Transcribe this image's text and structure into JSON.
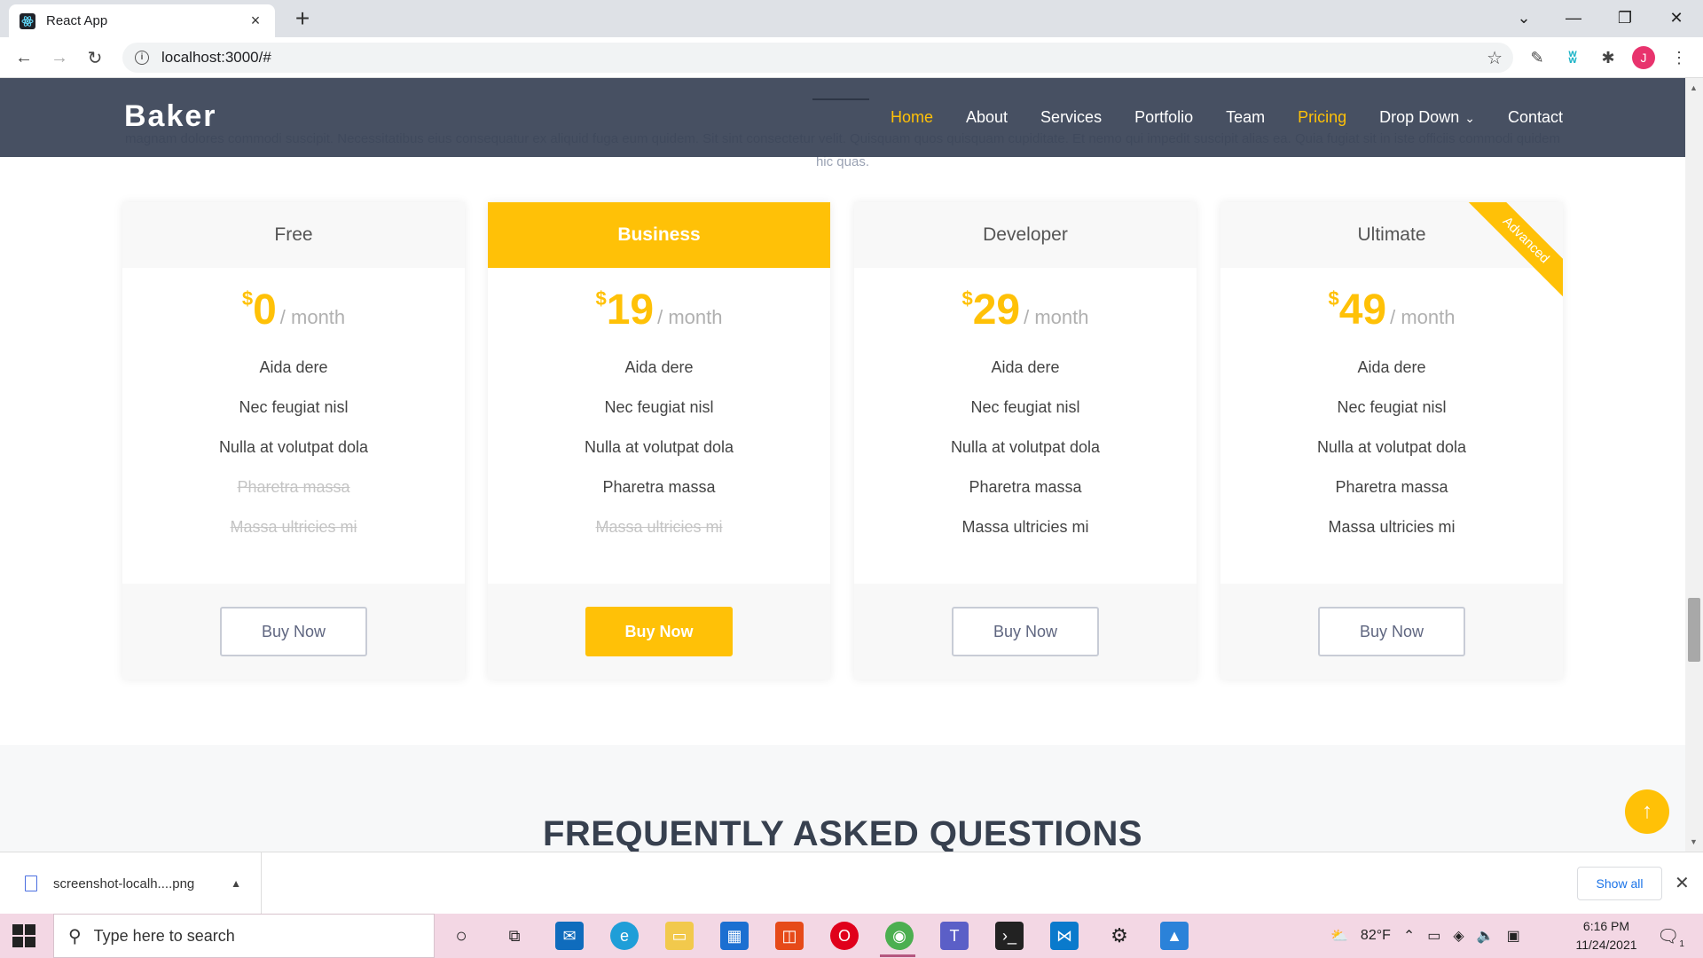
{
  "browser": {
    "tab_title": "React App",
    "tab_close": "×",
    "new_tab": "+",
    "url": "localhost:3000/#",
    "window_controls": [
      "⌄",
      "—",
      "❐",
      "✕"
    ],
    "profile_initial": "J"
  },
  "header": {
    "logo": "Baker",
    "nav": [
      {
        "label": "Home",
        "active": true
      },
      {
        "label": "About",
        "active": false
      },
      {
        "label": "Services",
        "active": false
      },
      {
        "label": "Portfolio",
        "active": false
      },
      {
        "label": "Team",
        "active": false
      },
      {
        "label": "Pricing",
        "active": true
      },
      {
        "label": "Drop Down",
        "active": false
      },
      {
        "label": "Contact",
        "active": false
      }
    ]
  },
  "background_text": "magnam dolores commodi suscipit. Necessitatibus eius consequatur ex aliquid fuga eum quidem. Sit sint consectetur velit. Quisquam quos quisquam cupiditate. Et nemo qui impedit suscipit alias ea. Quia fugiat sit in iste officiis commodi quidem hic quas.",
  "pricing": {
    "cards": [
      {
        "name": "Free",
        "currency": "$",
        "amount": "0",
        "period": "/ month",
        "features": [
          "Aida dere",
          "Nec feugiat nisl",
          "Nulla at volutpat dola",
          "Pharetra massa",
          "Massa ultricies mi"
        ],
        "button": "Buy Now"
      },
      {
        "name": "Business",
        "currency": "$",
        "amount": "19",
        "period": "/ month",
        "features": [
          "Aida dere",
          "Nec feugiat nisl",
          "Nulla at volutpat dola",
          "Pharetra massa",
          "Massa ultricies mi"
        ],
        "button": "Buy Now"
      },
      {
        "name": "Developer",
        "currency": "$",
        "amount": "29",
        "period": "/ month",
        "features": [
          "Aida dere",
          "Nec feugiat nisl",
          "Nulla at volutpat dola",
          "Pharetra massa",
          "Massa ultricies mi"
        ],
        "button": "Buy Now"
      },
      {
        "name": "Ultimate",
        "currency": "$",
        "amount": "49",
        "period": "/ month",
        "ribbon": "Advanced",
        "features": [
          "Aida dere",
          "Nec feugiat nisl",
          "Nulla at volutpat dola",
          "Pharetra massa",
          "Massa ultricies mi"
        ],
        "button": "Buy Now"
      }
    ]
  },
  "faq": {
    "title": "FREQUENTLY ASKED QUESTIONS"
  },
  "back_to_top": "↑",
  "downloads": {
    "file": "screenshot-localh....png",
    "show_all": "Show all"
  },
  "taskbar": {
    "search_placeholder": "Type here to search",
    "weather": "82°F",
    "time": "6:16 PM",
    "date": "11/24/2021",
    "notification_count": "1"
  },
  "colors": {
    "accent": "#ffc107",
    "header_bg": "#374155",
    "text": "#444444"
  }
}
